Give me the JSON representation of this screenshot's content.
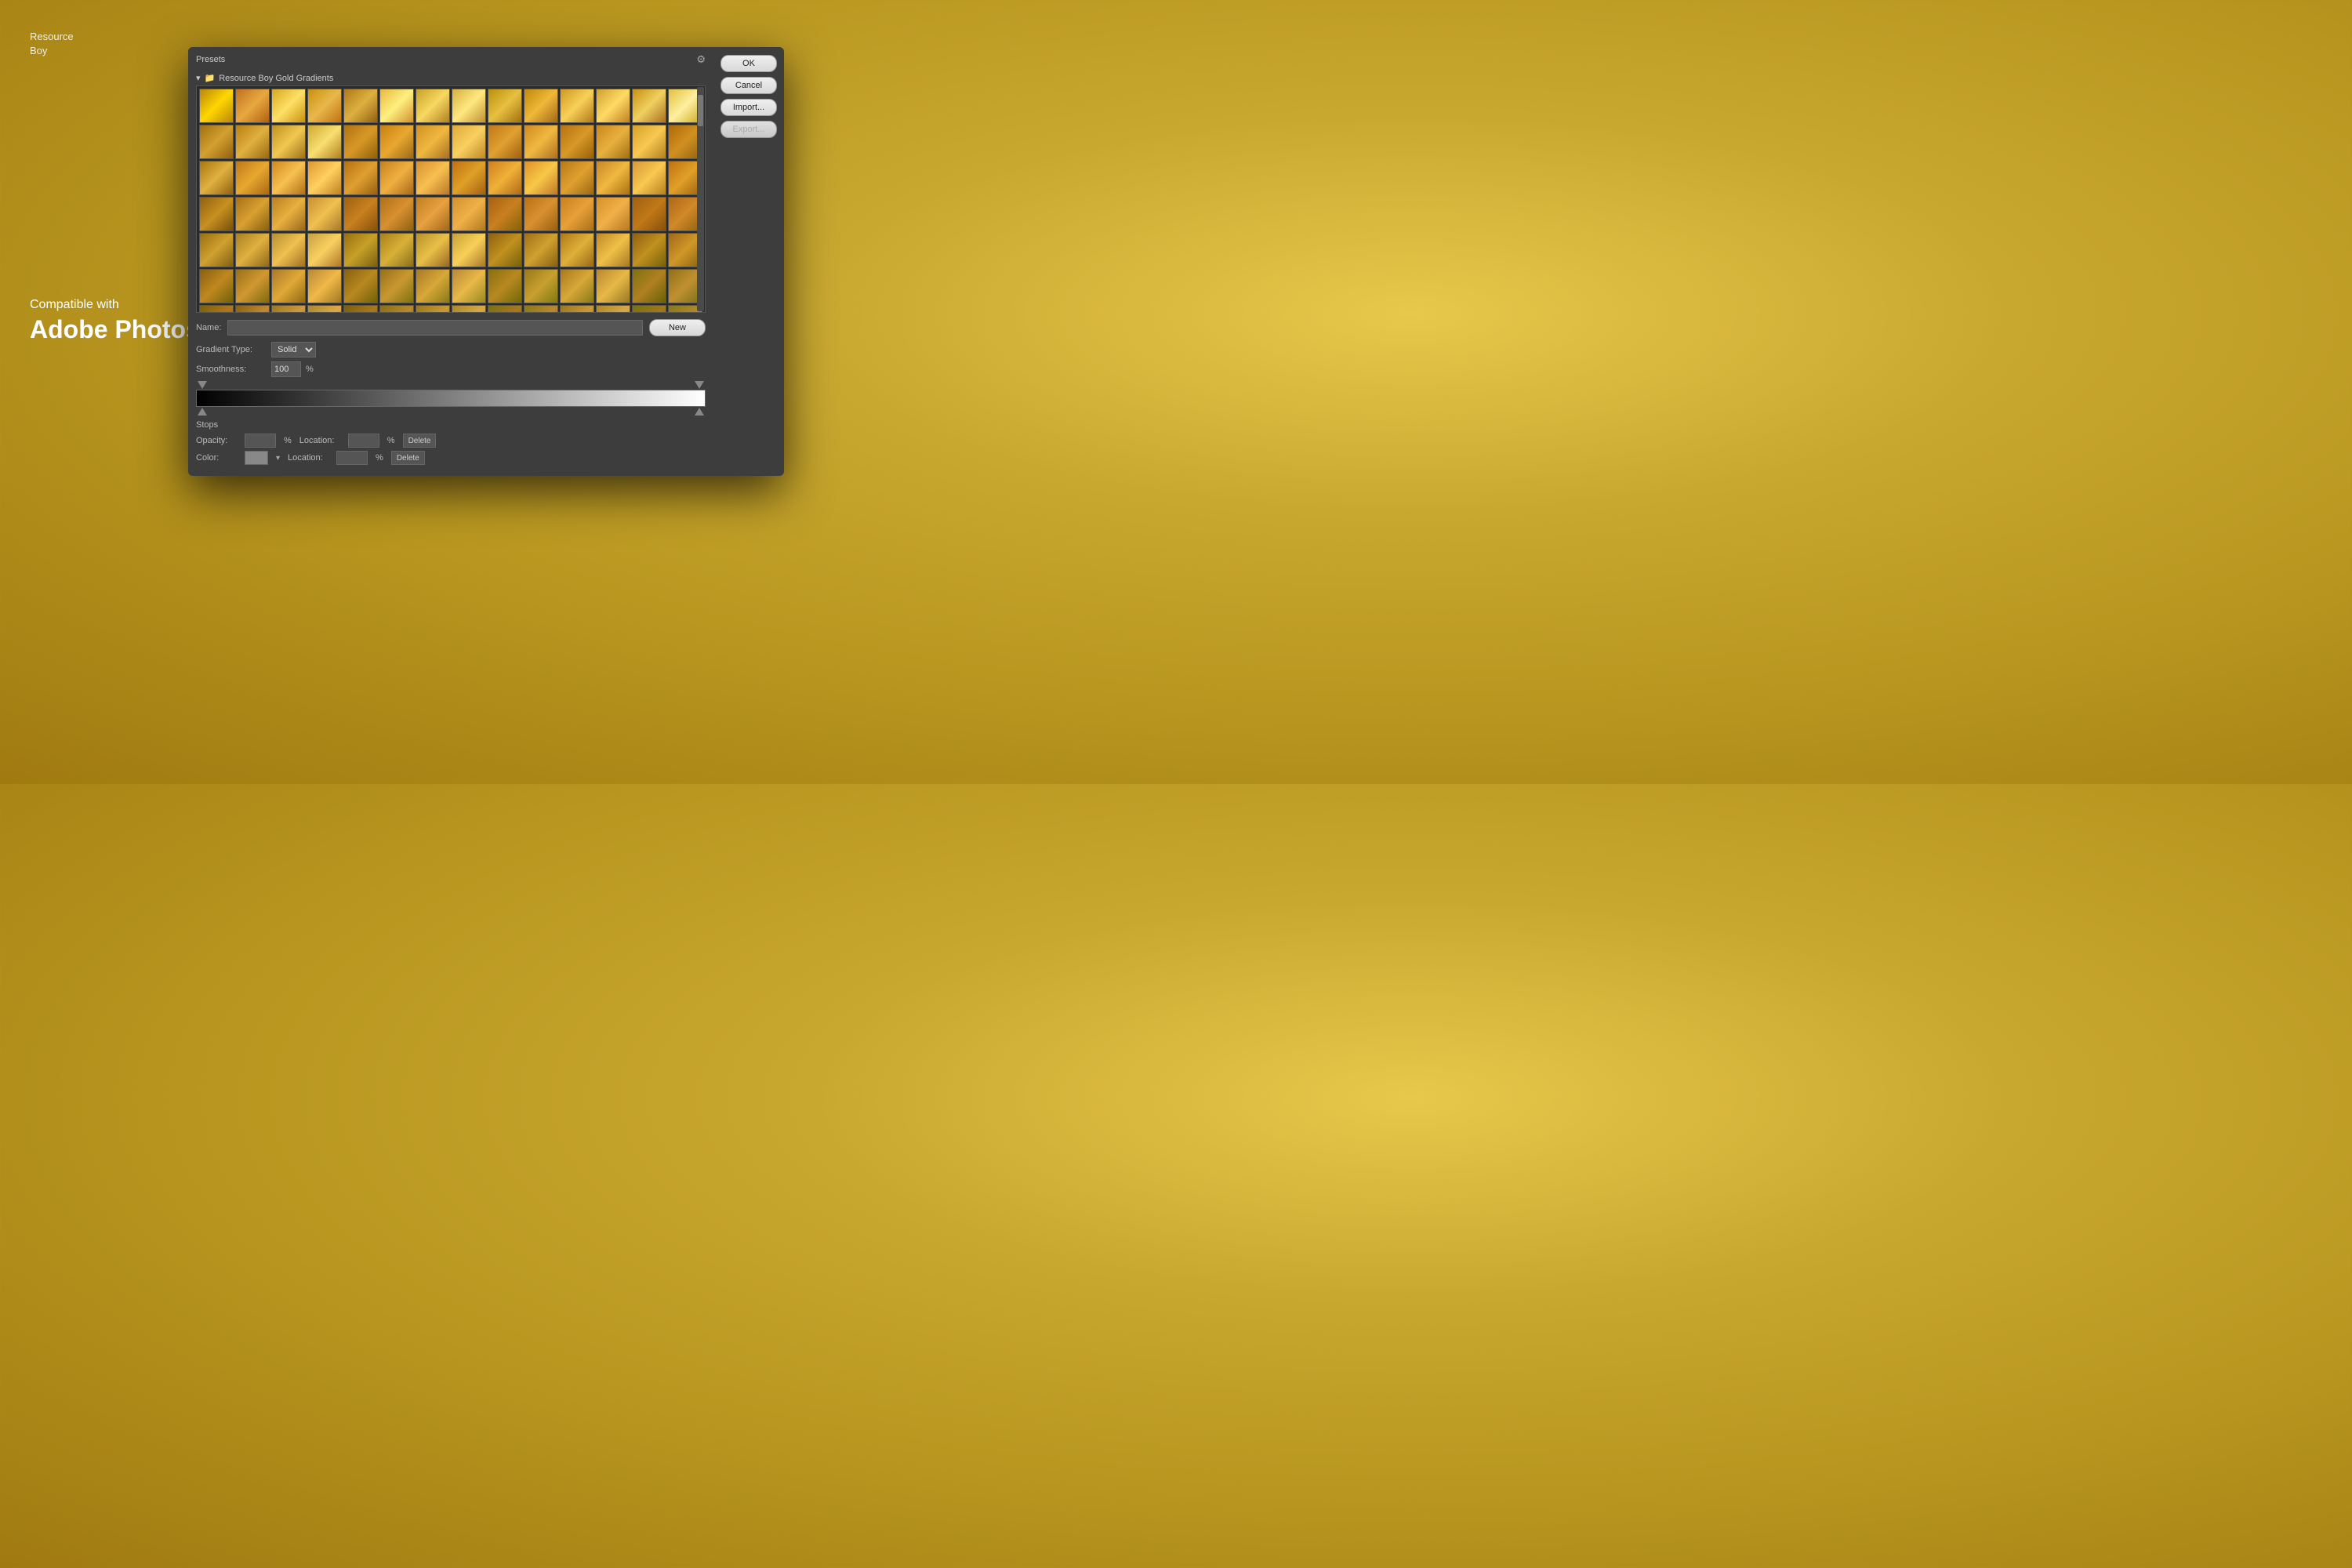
{
  "watermark": {
    "line1": "Resource",
    "line2": "Boy"
  },
  "compat": {
    "small": "Compatible with",
    "large": "Adobe Photoshop"
  },
  "dialog": {
    "presets_label": "Presets",
    "folder_name": "Resource Boy Gold Gradients",
    "name_label": "Name:",
    "gradient_type_label": "Gradient Type:",
    "gradient_type_value": "Solid",
    "smoothness_label": "Smoothness:",
    "smoothness_value": "100",
    "smoothness_unit": "%",
    "stops_title": "Stops",
    "opacity_label": "Opacity:",
    "opacity_unit": "%",
    "location_label": "Location:",
    "location_unit": "%",
    "delete_label": "Delete",
    "color_label": "Color:",
    "buttons": {
      "ok": "OK",
      "cancel": "Cancel",
      "import": "Import...",
      "export": "Export...",
      "new": "New"
    }
  },
  "gradients": [
    [
      "#b8860b,#ffd700,#b8860b",
      "#c8910c,#e8b84b,#c07010",
      "#d4a820,#ffe066,#c89010",
      "#e0c040,#fff0a0,#c8a820",
      "#c07020,#e8a840,#b06010",
      "#d0a030,#ffda65,#c08020",
      "#c89010,#f0d060,#a87020",
      "#b07818,#ddb040,#906010",
      "#e8b840,#fff080,#d09030",
      "#c8a028,#f8d860,#b08020",
      "#d4b040,#ffe880,#c09030",
      "#b8900c,#e8c040,#a07010",
      "#c0880e,#f0b838,#a06818",
      "#d09820,#f8d058,#b07818"
    ],
    [
      "#a07010,#d4a030,#906010",
      "#b88010,#e0b040,#9a6810",
      "#c09020,#f0c850,#a07018",
      "#d0a830,#f8e070,#b08020",
      "#b07010,#d89828,#906008",
      "#c88010,#e8a830,#a06818",
      "#d09020,#f0b840,#a87020",
      "#e0a838,#f8d060,#c08828",
      "#c07818,#e0a030,#a06010",
      "#d08820,#f0b840,#b07020",
      "#b87010,#d89828,#986008",
      "#c88818,#e8b040,#a07010",
      "#d8a028,#f8c850,#b08020",
      "#b06808,#d09020,#906010"
    ],
    [
      "#a8780e,#e0b040,#906010",
      "#c07818,#e8a830,#a86810",
      "#d08820,#f8c050,#b07018",
      "#e09830,#ffd060,#c08020",
      "#b87010,#e0a030,#986010",
      "#c88020,#f0b040,#a86818",
      "#d89030,#f8c050,#b87828",
      "#c07010,#e0a028,#a06010",
      "#d08020,#f0b038,#b06818",
      "#e09028,#f8c848,#c07828",
      "#b87818,#e0a030,#9a6810",
      "#c88828,#f0b840,#a87010",
      "#d89838,#f8c850,#b88020",
      "#c07010,#e0a028,#9a6010"
    ],
    [
      "#906010,#c89020,#785008",
      "#a87018,#d8a030,#886010",
      "#b88020,#e8b040,#986818",
      "#c89030,#f0c050,#a87828",
      "#a06010,#c88020,#885008",
      "#b07018,#d89030,#906010",
      "#c08020,#e8a040,#a06818",
      "#d09030,#f0b048,#b07820",
      "#a86010,#c88020,#886008",
      "#b87018,#d89030,#986010",
      "#c88020,#e8a038,#a87018",
      "#d89028,#f0b048,#b87820",
      "#a06010,#c07818,#885008",
      "#b06818,#d08828,#906010"
    ],
    [
      "#987010,#d0a030,#806010",
      "#a88020,#e0b040,#906818",
      "#b89030,#f0c050,#a07020",
      "#c8a040,#f8d060,#b07828",
      "#987010,#c8a028,#786010",
      "#a88018,#d8b038,#887018",
      "#b89028,#e8c048,#986820",
      "#c8a038,#f8d058,#a87828",
      "#906010,#c09020,#786008",
      "#a07018,#d0a030,#886010",
      "#b07818,#e0b038,#986818",
      "#c08828,#f0c048,#a87820",
      "#906010,#c09020,#786008",
      "#a06818,#d09828,#886010"
    ],
    [
      "#886010,#c08820,#706008",
      "#987018,#d09830,#806810",
      "#a87828,#e0a838,#906810",
      "#b88838,#f0b848,#a07820",
      "#886010,#b88820,#706008",
      "#987018,#c89830,#807010",
      "#a87828,#d8a838,#887818",
      "#b88838,#e8b848,#988820",
      "#887010,#b88820,#706808",
      "#987818,#c8a030,#807810",
      "#a87820,#d8a838,#887818",
      "#b88830,#e8b848,#987820",
      "#807010,#b08020,#686008",
      "#907018,#c09030,#787018"
    ],
    [
      "#786008,#b07820,#606008",
      "#886010,#c08830,#706810",
      "#987820,#d09840,#806818",
      "#a88830,#e0a848,#907820",
      "#786008,#a87820,#606008",
      "#887010,#b88830,#707010",
      "#987818,#c89838,#807818",
      "#a88828,#d8a848,#888020",
      "#787010,#a87820,#608010",
      "#887818,#b88830,#707818",
      "#987820,#c89838,#807820",
      "#a88828,#d8a848,#888020",
      "#787010,#a07820,#606010",
      "#887818,#b08830,#706818"
    ],
    [
      "#e8c070,#fff8c0,#e0b058",
      "#f0c878,#fffac8,#e8b860",
      "#f8d080,#fffc d0,#f0c068",
      "#f0c870,#fff8c0,#e8b858",
      "#e8b860,#fff090,#d8a048",
      "#f0c068,#fff8a0,#e0a850",
      "#e0b058,#ffe880,#d09840",
      "#d8a848,#ffd870,#c89030",
      "#f0c870,#fff8b0,#e8b058",
      "#e8b860,#fff098,#d8a848",
      "#f8c068,#fff8a8,#e0a850",
      "#e0b058,#ffe888,#d09840",
      "#d8a848,#ffd878,#c89038",
      "#c8a038,#ffc868,#b88028"
    ]
  ]
}
